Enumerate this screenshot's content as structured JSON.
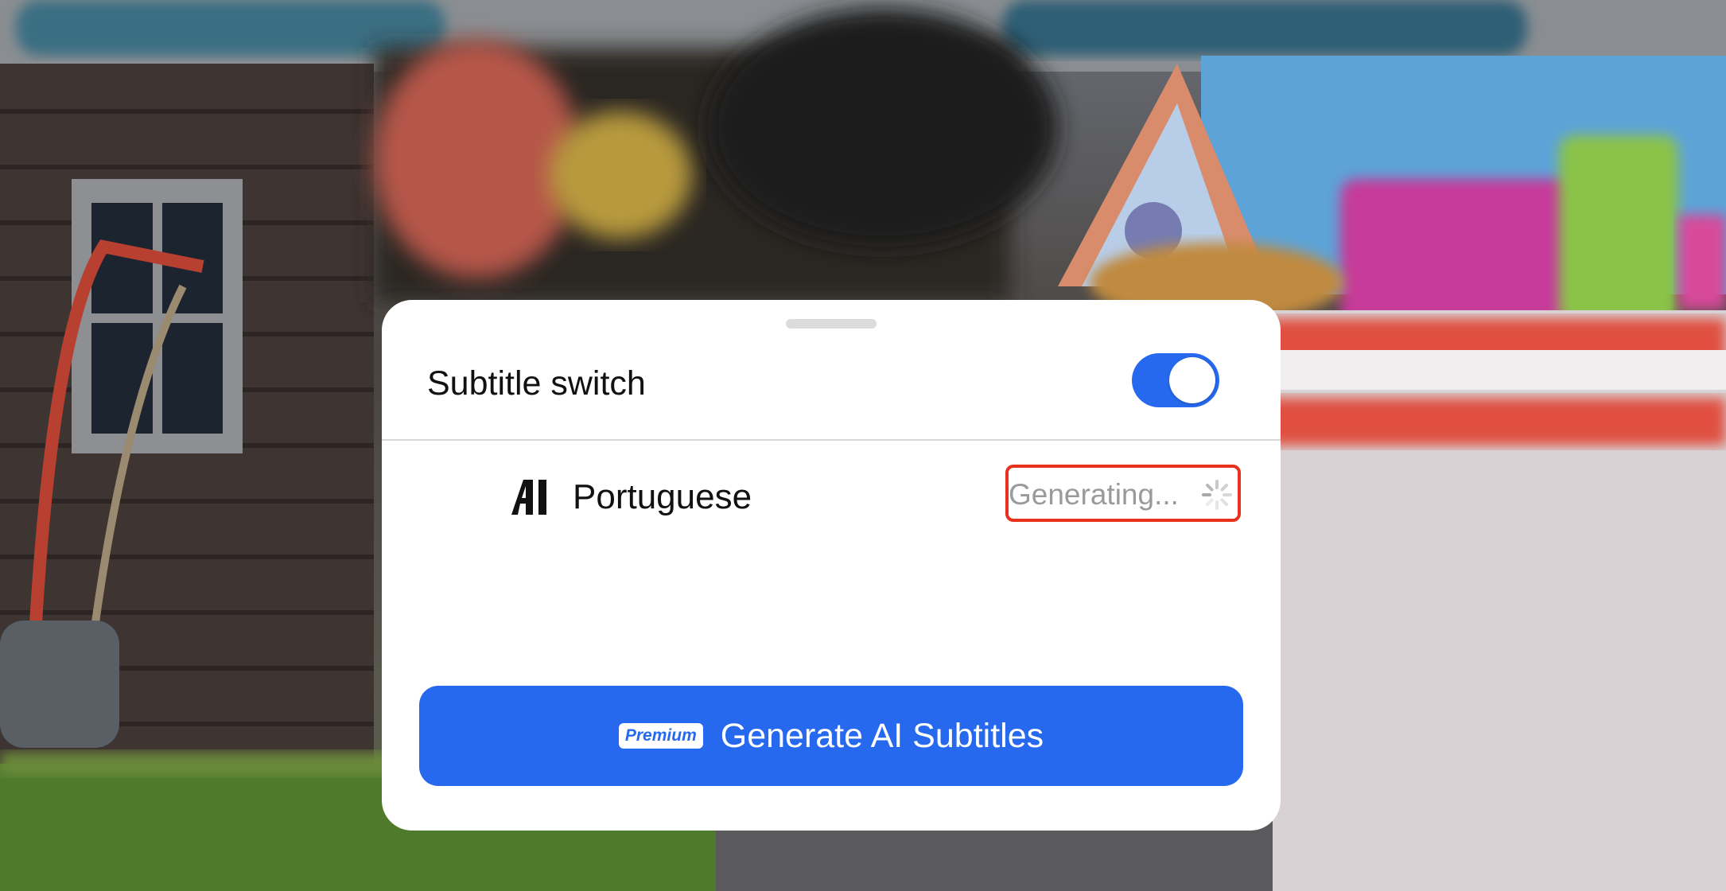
{
  "sheet": {
    "subtitle_switch_label": "Subtitle switch",
    "subtitle_switch_on": true,
    "language_row": {
      "icon": "ai-icon",
      "language": "Portuguese",
      "status": "Generating..."
    },
    "generate_button": {
      "badge": "Premium",
      "label": "Generate AI Subtitles"
    }
  },
  "colors": {
    "accent": "#2669ee",
    "highlight_box": "#e8321e",
    "status_text": "#9a9a9a"
  }
}
